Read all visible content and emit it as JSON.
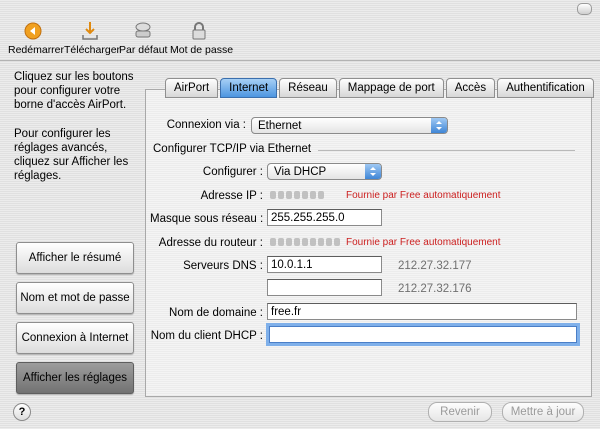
{
  "toolbar": {
    "items": [
      {
        "label": "Redémarrer",
        "icon": "restart-icon"
      },
      {
        "label": "Télécharger",
        "icon": "download-icon"
      },
      {
        "label": "Par défaut",
        "icon": "default-icon"
      },
      {
        "label": "Mot de passe",
        "icon": "lock-icon"
      }
    ]
  },
  "sidebar": {
    "instructions_1": "Cliquez sur les boutons pour configurer votre borne d'accès AirPort.",
    "instructions_2": "Pour configurer les réglages avancés, cliquez sur Afficher les réglages.",
    "buttons": [
      {
        "label": "Afficher le résumé"
      },
      {
        "label": "Nom et mot de passe"
      },
      {
        "label": "Connexion à Internet"
      },
      {
        "label": "Afficher les réglages"
      }
    ]
  },
  "tabs": [
    "AirPort",
    "Internet",
    "Réseau",
    "Mappage de port",
    "Accès",
    "Authentification"
  ],
  "form": {
    "connexion_label": "Connexion via :",
    "connexion_value": "Ethernet",
    "section_title": "Configurer TCP/IP via Ethernet",
    "configurer_label": "Configurer :",
    "configurer_value": "Via DHCP",
    "ip_label": "Adresse IP :",
    "ip_note": "Fournie par Free automatiquement",
    "mask_label": "Masque sous réseau :",
    "mask_value": "255.255.255.0",
    "router_label": "Adresse du routeur :",
    "router_note": "Fournie par Free automatiquement",
    "dns_label": "Serveurs DNS :",
    "dns1_value": "10.0.1.1",
    "dns1_auto": "212.27.32.177",
    "dns2_value": "",
    "dns2_auto": "212.27.32.176",
    "domain_label": "Nom de domaine :",
    "domain_value": "free.fr",
    "dhcp_client_label": "Nom du client DHCP :",
    "dhcp_client_value": ""
  },
  "footer": {
    "help": "?",
    "revert": "Revenir",
    "update": "Mettre à jour"
  },
  "colors": {
    "selected_tab": "#4d95e0",
    "note": "#cc1f1f",
    "focus_ring": "#7fb0ea"
  }
}
